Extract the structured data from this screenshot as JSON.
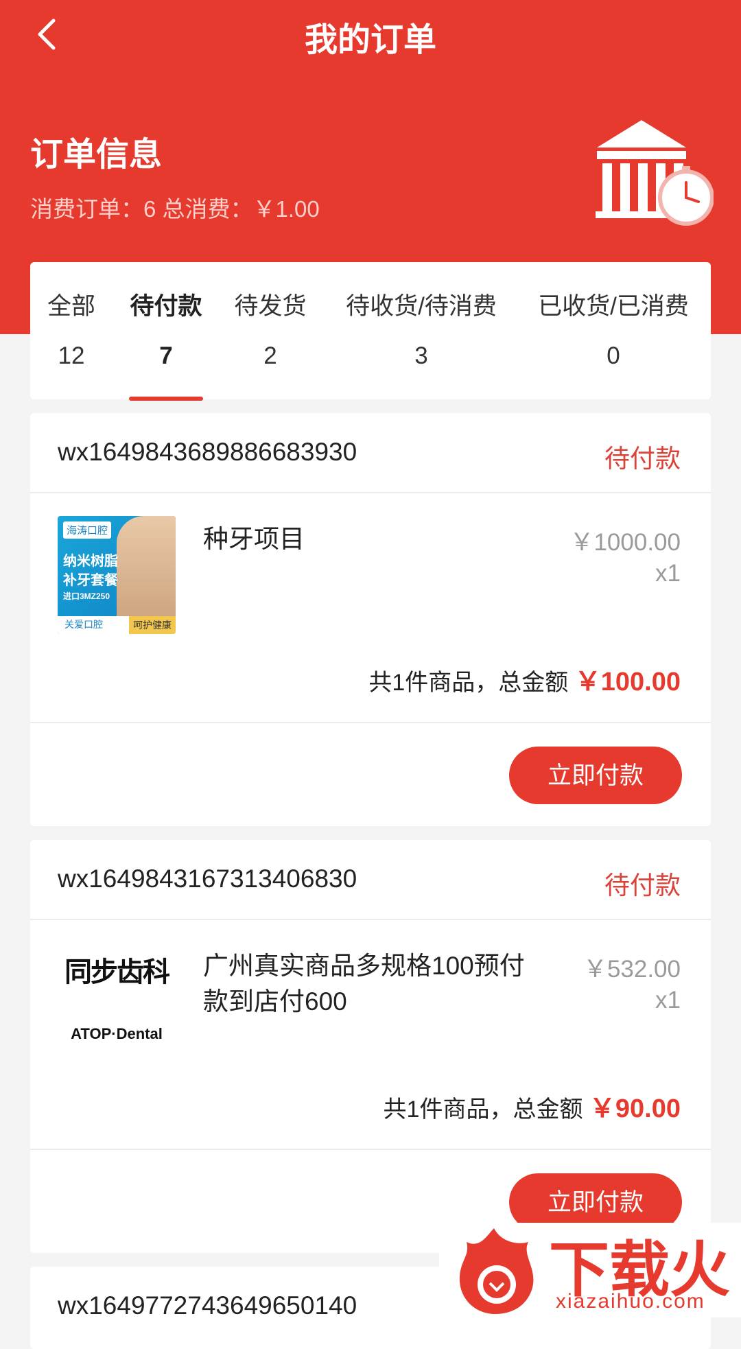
{
  "header": {
    "title": "我的订单",
    "back_icon": "chevron-left-icon"
  },
  "info": {
    "title": "订单信息",
    "summary": "消费订单：6 总消费：￥1.00",
    "illustration": "store-clock-icon"
  },
  "tabs": [
    {
      "label": "全部",
      "count": "12"
    },
    {
      "label": "待付款",
      "count": "7",
      "active": true
    },
    {
      "label": "待发货",
      "count": "2"
    },
    {
      "label": "待收货/待消费",
      "count": "3"
    },
    {
      "label": "已收货/已消费",
      "count": "0"
    }
  ],
  "orders": [
    {
      "id": "wx1649843689886683930",
      "status": "待付款",
      "image": {
        "brand": "海涛口腔",
        "headline1": "纳米树脂",
        "headline2": "补牙套餐",
        "sub": "进口3MZ250",
        "left_tag": "关爱口腔",
        "right_tag": "呵护健康"
      },
      "name": "种牙项目",
      "price": "￥1000.00",
      "qty": "x1",
      "summary_prefix": "共1件商品，总金额",
      "total": "￥100.00",
      "button": "立即付款"
    },
    {
      "id": "wx1649843167313406830",
      "status": "待付款",
      "image": {
        "logo_cn": "同步齿科",
        "logo_en": "ATOP·Dental"
      },
      "name": "广州真实商品多规格100预付款到店付600",
      "price": "￥532.00",
      "qty": "x1",
      "summary_prefix": "共1件商品，总金额",
      "total": "￥90.00",
      "button": "立即付款"
    },
    {
      "id": "wx1649772743649650140"
    }
  ],
  "watermark": {
    "text": "下载火",
    "url": "xiazaihuo.com"
  },
  "colors": {
    "primary": "#e53a2d",
    "background": "#f4f4f4"
  }
}
